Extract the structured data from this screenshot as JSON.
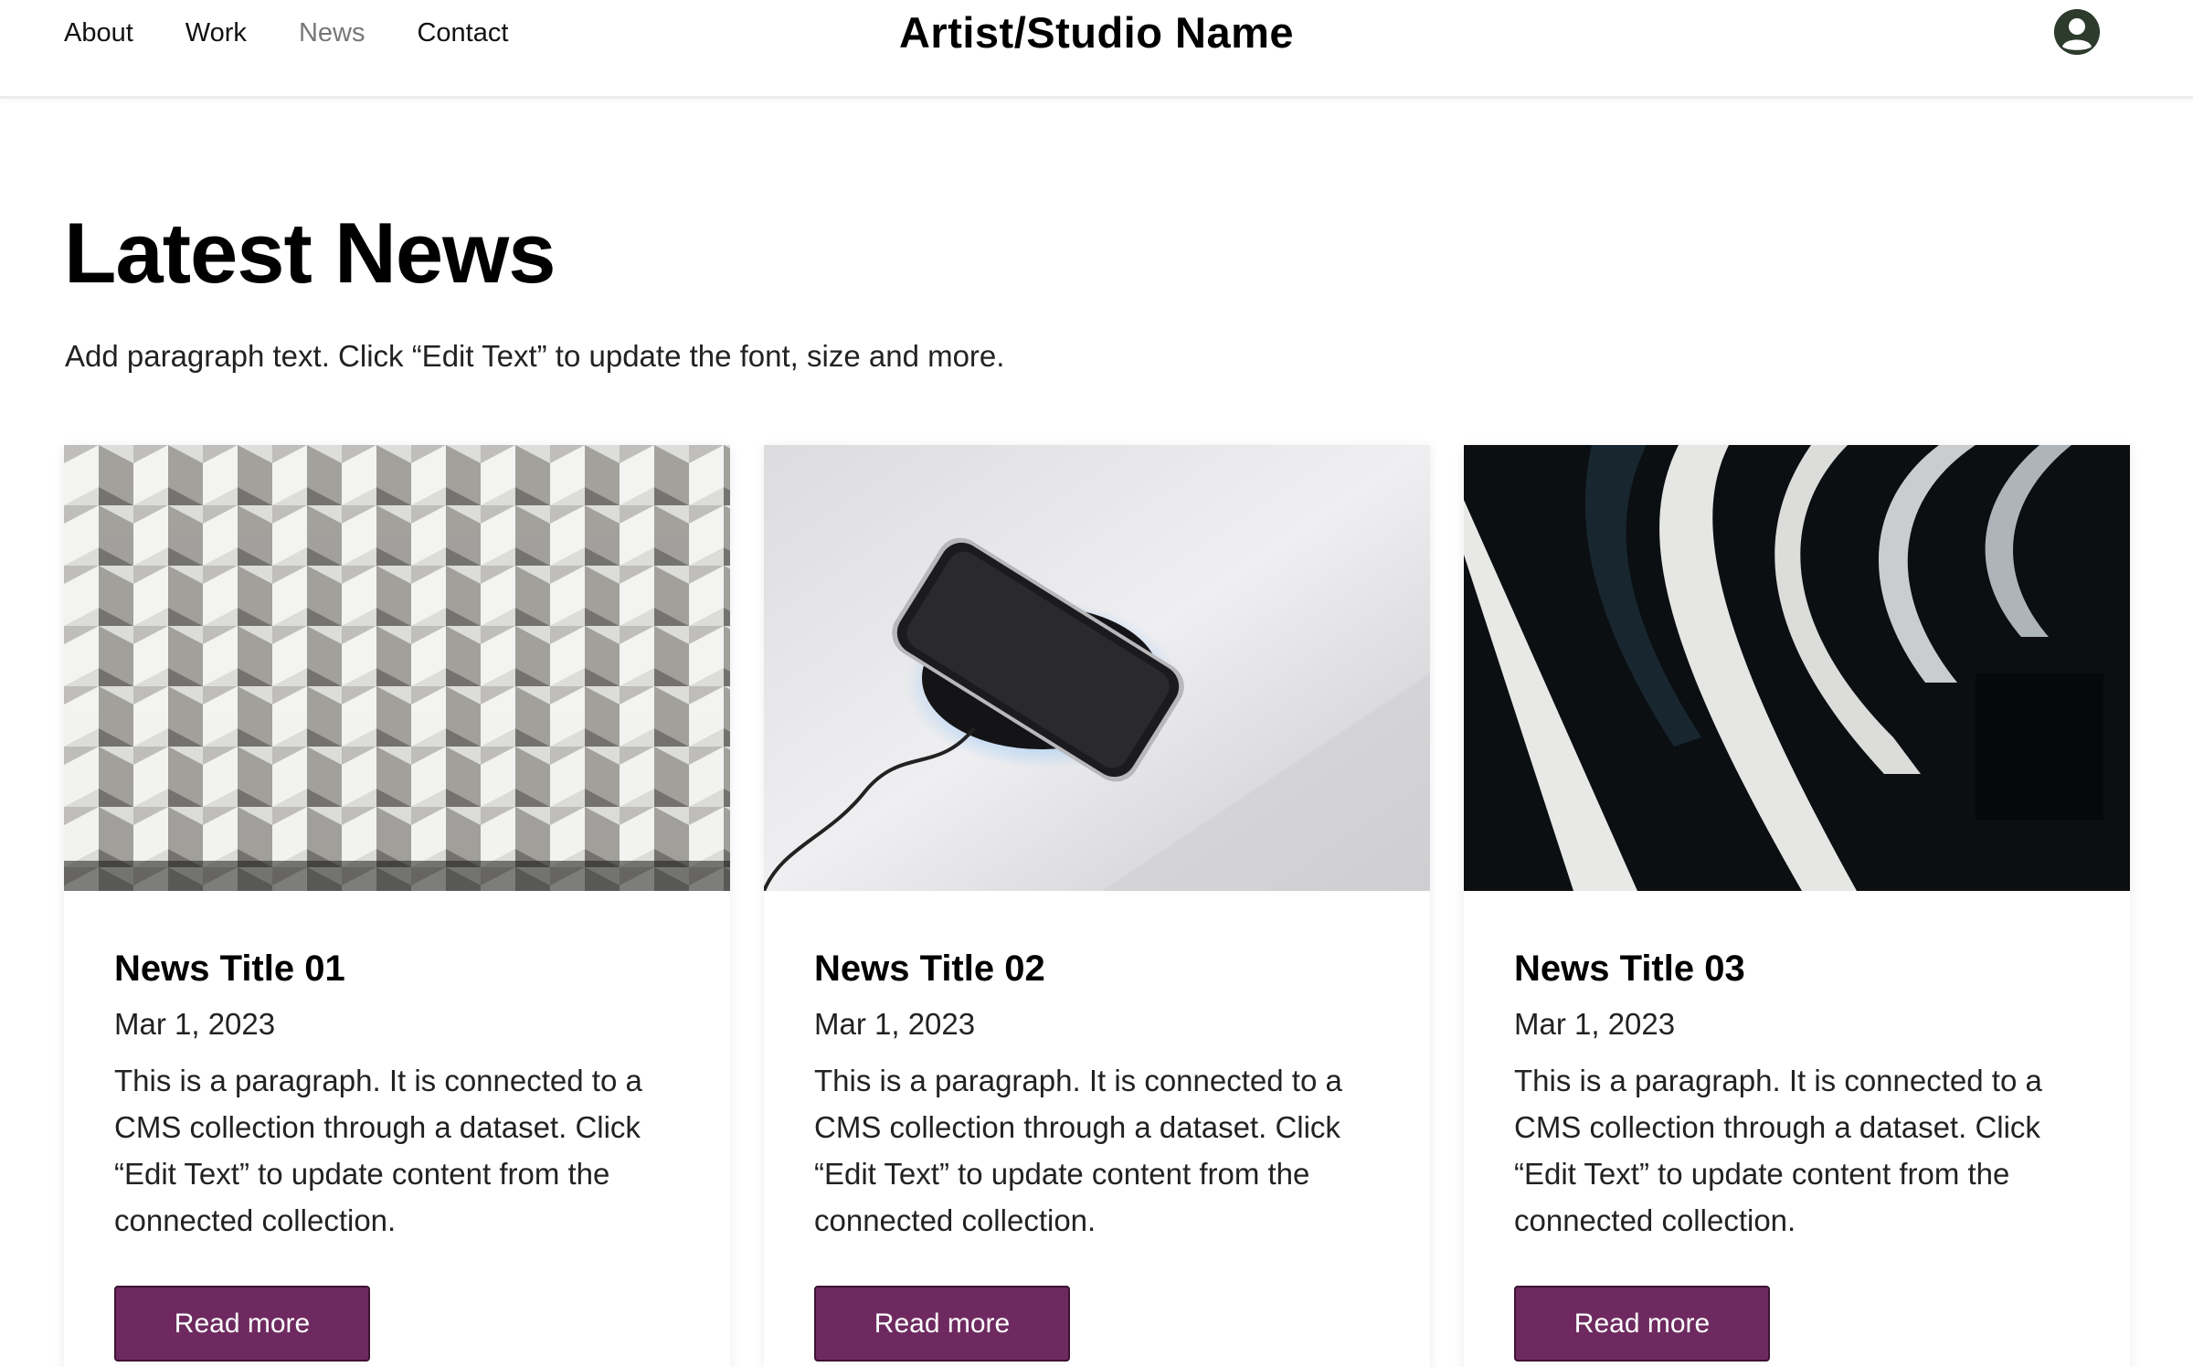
{
  "header": {
    "nav": [
      {
        "label": "About"
      },
      {
        "label": "Work"
      },
      {
        "label": "News"
      },
      {
        "label": "Contact"
      }
    ],
    "site_title": "Artist/Studio Name",
    "avatar_icon": "user-avatar-icon"
  },
  "main": {
    "title": "Latest News",
    "intro": "Add paragraph text. Click “Edit Text” to update the font, size and more."
  },
  "cards": [
    {
      "image": "silver-geometric-facade-image",
      "title": "News Title 01",
      "date": "Mar 1, 2023",
      "text": "This is a paragraph. It is connected to a CMS collection through a dataset. Click “Edit Text” to update content from the connected collection.",
      "button": "Read more"
    },
    {
      "image": "phone-wireless-charger-image",
      "title": "News Title 02",
      "date": "Mar 1, 2023",
      "text": "This is a paragraph. It is connected to a CMS collection through a dataset. Click “Edit Text” to update content from the connected collection.",
      "button": "Read more"
    },
    {
      "image": "dark-spiral-staircase-image",
      "title": "News Title 03",
      "date": "Mar 1, 2023",
      "text": "This is a paragraph. It is connected to a CMS collection through a dataset. Click “Edit Text” to update content from the connected collection.",
      "button": "Read more"
    }
  ],
  "colors": {
    "button_bg": "#6e2a60",
    "active_nav": "#777777",
    "avatar_bg": "#2d3b2d"
  }
}
